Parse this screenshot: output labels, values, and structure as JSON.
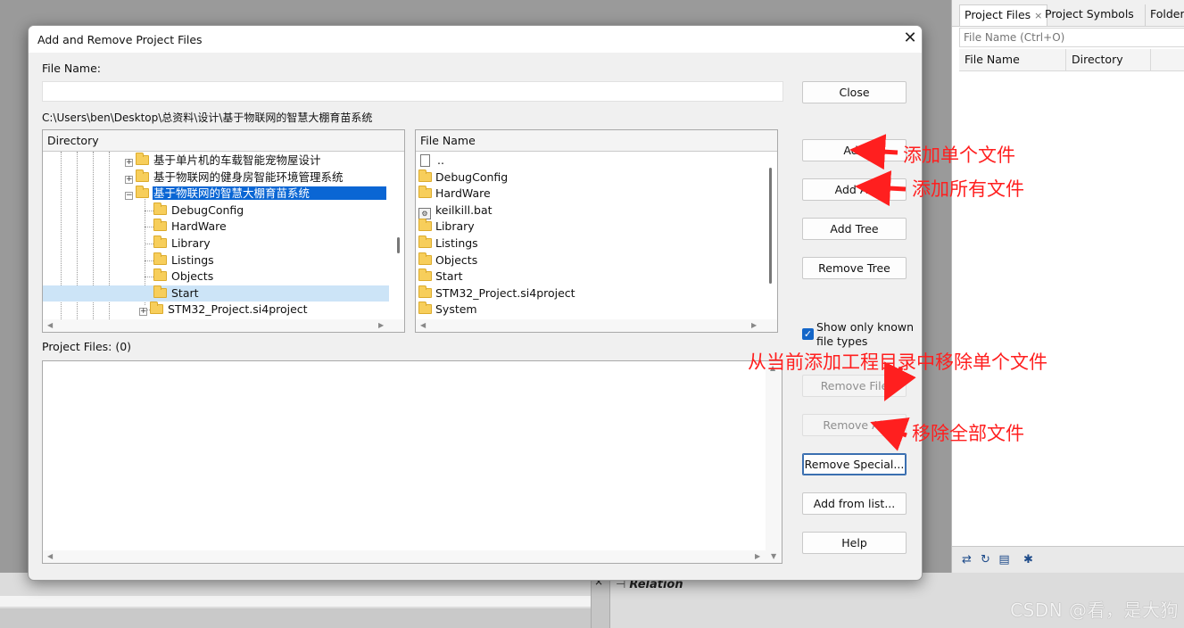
{
  "right_panel": {
    "tabs": [
      "Project Files",
      "Project Symbols",
      "Folders"
    ],
    "tab_close": "×",
    "search_placeholder": "File Name (Ctrl+O)",
    "columns": [
      "File Name",
      "Directory"
    ],
    "footer_icons": [
      "sync-icon",
      "refresh-icon",
      "list-icon",
      "settings-icon"
    ]
  },
  "bottom": {
    "close_x": "×",
    "relation_label": "Relation",
    "watermark": "CSDN @看，是大狗"
  },
  "dialog": {
    "title": "Add and Remove Project Files",
    "close_glyph": "✕",
    "file_name_label": "File Name:",
    "file_name_value": "",
    "current_path": "C:\\Users\\ben\\Desktop\\总资料\\设计\\基于物联网的智慧大棚育苗系统",
    "directory_header": "Directory",
    "directory_tree": [
      {
        "label": "基于单片机的车载智能宠物屋设计",
        "expander": "+",
        "level": 0,
        "selected": ""
      },
      {
        "label": "基于物联网的健身房智能环境管理系统",
        "expander": "+",
        "level": 0,
        "selected": ""
      },
      {
        "label": "基于物联网的智慧大棚育苗系统",
        "expander": "−",
        "level": 0,
        "selected": "focus"
      },
      {
        "label": "DebugConfig",
        "expander": "",
        "level": 1,
        "selected": ""
      },
      {
        "label": "HardWare",
        "expander": "",
        "level": 1,
        "selected": ""
      },
      {
        "label": "Library",
        "expander": "",
        "level": 1,
        "selected": ""
      },
      {
        "label": "Listings",
        "expander": "",
        "level": 1,
        "selected": ""
      },
      {
        "label": "Objects",
        "expander": "",
        "level": 1,
        "selected": ""
      },
      {
        "label": "Start",
        "expander": "",
        "level": 1,
        "selected": "light"
      },
      {
        "label": "STM32_Project.si4project",
        "expander": "+",
        "level": 1,
        "selected": ""
      }
    ],
    "file_header": "File Name",
    "files": [
      {
        "name": "..",
        "icon": "doc"
      },
      {
        "name": "DebugConfig",
        "icon": "folder"
      },
      {
        "name": "HardWare",
        "icon": "folder"
      },
      {
        "name": "keilkill.bat",
        "icon": "bat"
      },
      {
        "name": "Library",
        "icon": "folder"
      },
      {
        "name": "Listings",
        "icon": "folder"
      },
      {
        "name": "Objects",
        "icon": "folder"
      },
      {
        "name": "Start",
        "icon": "folder"
      },
      {
        "name": "STM32_Project.si4project",
        "icon": "folder"
      },
      {
        "name": "System",
        "icon": "folder"
      }
    ],
    "project_files_label": "Project Files: (0)",
    "show_only_known": {
      "label": "Show only known file types",
      "checked": true
    },
    "buttons": {
      "close": "Close",
      "add": "Add",
      "add_all": "Add All",
      "add_tree": "Add Tree",
      "remove_tree": "Remove Tree",
      "remove_file": "Remove File",
      "remove_all": "Remove All",
      "remove_special": "Remove Special...",
      "add_from_list": "Add from list...",
      "help": "Help"
    }
  },
  "annotations": {
    "add_single": "添加单个文件",
    "add_all": "添加所有文件",
    "remove_single": "从当前添加工程目录中移除单个文件",
    "remove_all": "移除全部文件",
    "color": "#ff1f1f"
  }
}
